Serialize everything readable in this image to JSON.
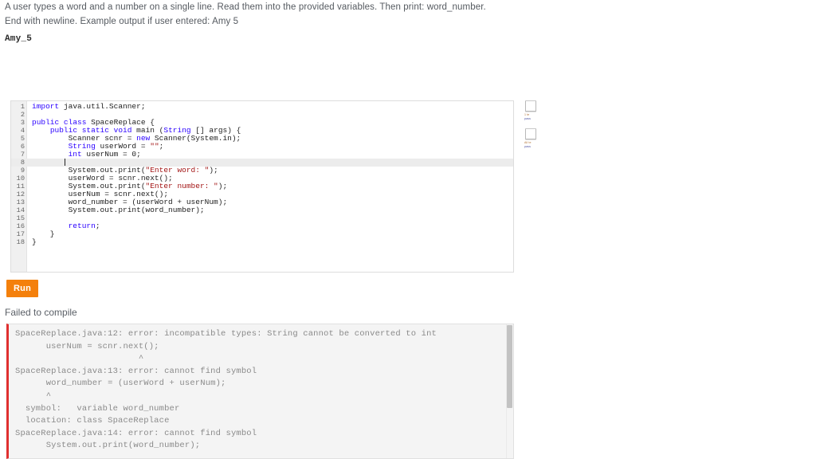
{
  "prompt": {
    "text": "A user types a word and a number on a single line. Read them into the provided variables. Then print: word_number. End with newline. Example output if user entered: Amy 5",
    "example_output": "Amy_5"
  },
  "editor": {
    "lines": [
      {
        "n": "1",
        "code": "import java.util.Scanner;"
      },
      {
        "n": "2",
        "code": ""
      },
      {
        "n": "3",
        "code": "public class SpaceReplace {"
      },
      {
        "n": "4",
        "code": "    public static void main (String [] args) {"
      },
      {
        "n": "5",
        "code": "        Scanner scnr = new Scanner(System.in);"
      },
      {
        "n": "6",
        "code": "        String userWord = \"\";"
      },
      {
        "n": "7",
        "code": "        int userNum = 0;"
      },
      {
        "n": "8",
        "code": ""
      },
      {
        "n": "9",
        "code": "        System.out.print(\"Enter word: \");"
      },
      {
        "n": "10",
        "code": "        userWord = scnr.next();"
      },
      {
        "n": "11",
        "code": "        System.out.print(\"Enter number: \");"
      },
      {
        "n": "12",
        "code": "        userNum = scnr.next();"
      },
      {
        "n": "13",
        "code": "        word_number = (userWord + userNum);"
      },
      {
        "n": "14",
        "code": "        System.out.print(word_number);"
      },
      {
        "n": "15",
        "code": ""
      },
      {
        "n": "16",
        "code": "        return;"
      },
      {
        "n": "17",
        "code": "    }"
      },
      {
        "n": "18",
        "code": "}"
      }
    ],
    "active_line": "8",
    "language": "java",
    "class_name": "SpaceReplace"
  },
  "test_rail": {
    "blocks": [
      {
        "icon": "run-test-button",
        "label_line1": "1 te",
        "label_line2": "pass"
      },
      {
        "icon": "run-all-tests-button",
        "label_line1": "All te",
        "label_line2": "pass"
      }
    ]
  },
  "toolbar": {
    "run_label": "Run"
  },
  "status": {
    "text": "Failed to compile"
  },
  "console": {
    "output": "SpaceReplace.java:12: error: incompatible types: String cannot be converted to int\n      userNum = scnr.next();\n                        ^\nSpaceReplace.java:13: error: cannot find symbol\n      word_number = (userWord + userNum);\n      ^\n  symbol:   variable word_number\n  location: class SpaceReplace\nSpaceReplace.java:14: error: cannot find symbol\n      System.out.print(word_number);",
    "accent_color": "#e03030",
    "scroll_thumb_visible": true
  },
  "colors": {
    "run_button": "#f4800c",
    "keyword": "#2a00ff",
    "string": "#a31515",
    "error_border": "#e03030"
  }
}
